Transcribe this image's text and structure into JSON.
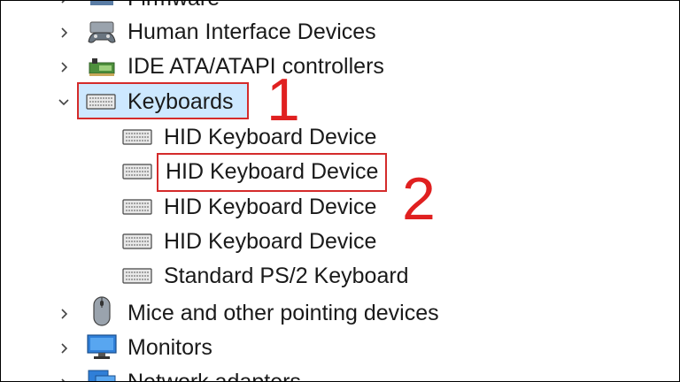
{
  "tree": {
    "items": [
      {
        "label": "Firmware",
        "icon": "firmware-icon",
        "expanded": false
      },
      {
        "label": "Human Interface Devices",
        "icon": "hid-gamepad-icon",
        "expanded": false
      },
      {
        "label": "IDE ATA/ATAPI controllers",
        "icon": "ide-controller-icon",
        "expanded": false
      },
      {
        "label": "Keyboards",
        "icon": "keyboard-icon",
        "expanded": true,
        "selected": true,
        "children": [
          {
            "label": "HID Keyboard Device",
            "icon": "keyboard-icon"
          },
          {
            "label": "HID Keyboard Device",
            "icon": "keyboard-icon",
            "highlighted": true
          },
          {
            "label": "HID Keyboard Device",
            "icon": "keyboard-icon"
          },
          {
            "label": "HID Keyboard Device",
            "icon": "keyboard-icon"
          },
          {
            "label": "Standard PS/2 Keyboard",
            "icon": "keyboard-icon"
          }
        ]
      },
      {
        "label": "Mice and other pointing devices",
        "icon": "mouse-icon",
        "expanded": false
      },
      {
        "label": "Monitors",
        "icon": "monitor-icon",
        "expanded": false
      },
      {
        "label": "Network adapters",
        "icon": "network-adapter-icon",
        "expanded": false
      }
    ]
  },
  "annotations": {
    "step1": "1",
    "step2": "2",
    "color": "#e02020"
  },
  "colors": {
    "selection": "#cde8ff",
    "highlight_border": "#d42b2b"
  }
}
